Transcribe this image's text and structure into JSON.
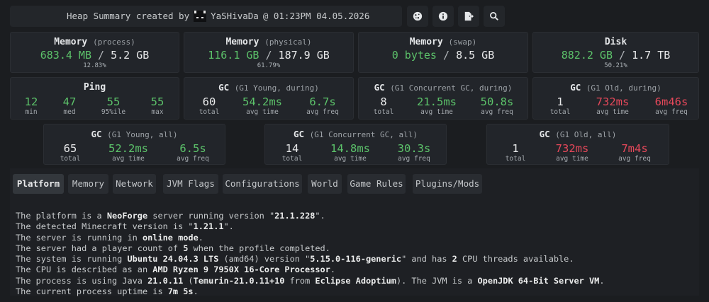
{
  "header": {
    "prefix": "Heap Summary created by",
    "user": "YaSHivaDa",
    "suffix": "@ 01:23PM 04.05.2026"
  },
  "toolbar": {
    "buttons": [
      {
        "icon": "cookie-icon"
      },
      {
        "icon": "info-icon"
      },
      {
        "icon": "export-icon"
      },
      {
        "icon": "search-icon"
      }
    ]
  },
  "memory": [
    {
      "title": "Memory",
      "sub": "(process)",
      "used": "683.4 MB",
      "sep": "/",
      "total": "5.2 GB",
      "pct": "12.83%"
    },
    {
      "title": "Memory",
      "sub": "(physical)",
      "used": "116.1 GB",
      "sep": "/",
      "total": "187.9 GB",
      "pct": "61.79%"
    },
    {
      "title": "Memory",
      "sub": "(swap)",
      "used": "0 bytes",
      "sep": "/",
      "total": "8.5 GB",
      "pct": ""
    },
    {
      "title": "Disk",
      "sub": "",
      "used": "882.2 GB",
      "sep": "/",
      "total": "1.7 TB",
      "pct": "50.21%"
    }
  ],
  "ping": {
    "title": "Ping",
    "stats": [
      {
        "value": "12",
        "label": "min"
      },
      {
        "value": "47",
        "label": "med"
      },
      {
        "value": "55",
        "label": "95%ile"
      },
      {
        "value": "55",
        "label": "max"
      }
    ]
  },
  "gc_row1": [
    {
      "title": "GC",
      "sub": "(G1 Young, during)",
      "total": "60",
      "avg_time": "54.2ms",
      "avg_freq": "6.7s"
    },
    {
      "title": "GC",
      "sub": "(G1 Concurrent GC, during)",
      "total": "8",
      "avg_time": "21.5ms",
      "avg_freq": "50.8s"
    },
    {
      "title": "GC",
      "sub": "(G1 Old, during)",
      "total": "1",
      "avg_time": "732ms",
      "avg_freq": "6m46s"
    }
  ],
  "gc_row2": [
    {
      "title": "GC",
      "sub": "(G1 Young, all)",
      "total": "65",
      "avg_time": "52.2ms",
      "avg_freq": "6.5s"
    },
    {
      "title": "GC",
      "sub": "(G1 Concurrent GC, all)",
      "total": "14",
      "avg_time": "14.8ms",
      "avg_freq": "30.3s"
    },
    {
      "title": "GC",
      "sub": "(G1 Old, all)",
      "total": "1",
      "avg_time": "732ms",
      "avg_freq": "7m4s"
    }
  ],
  "labels": {
    "total": "total",
    "avg_time": "avg time",
    "avg_freq": "avg freq"
  },
  "tabs": [
    "Platform",
    "Memory",
    "Network",
    "JVM Flags",
    "Configurations",
    "World",
    "Game Rules",
    "Plugins/Mods"
  ],
  "platform": {
    "l1": [
      "The platform is a ",
      "NeoForge",
      " server running version \"",
      "21.1.228",
      "\"."
    ],
    "l2": [
      "The detected Minecraft version is \"",
      "1.21.1",
      "\"."
    ],
    "l3": [
      "The server is running in ",
      "online mode",
      "."
    ],
    "l4": [
      "The server had a player count of ",
      "5",
      " when the profile completed."
    ],
    "l5": [
      "The system is running ",
      "Ubuntu 24.04.3 LTS",
      " (amd64) version \"",
      "5.15.0-116-generic",
      "\" and has ",
      "2",
      " CPU threads available."
    ],
    "l6": [
      "The CPU is described as an ",
      "AMD Ryzen 9 7950X 16-Core Processor",
      "."
    ],
    "l7": [
      "The process is using Java ",
      "21.0.11",
      " (",
      "Temurin-21.0.11+10",
      " from ",
      "Eclipse Adoptium",
      "). The JVM is a ",
      "OpenJDK 64-Bit Server VM",
      "."
    ],
    "l8": [
      "The current process uptime is ",
      "7m 5s",
      "."
    ]
  }
}
